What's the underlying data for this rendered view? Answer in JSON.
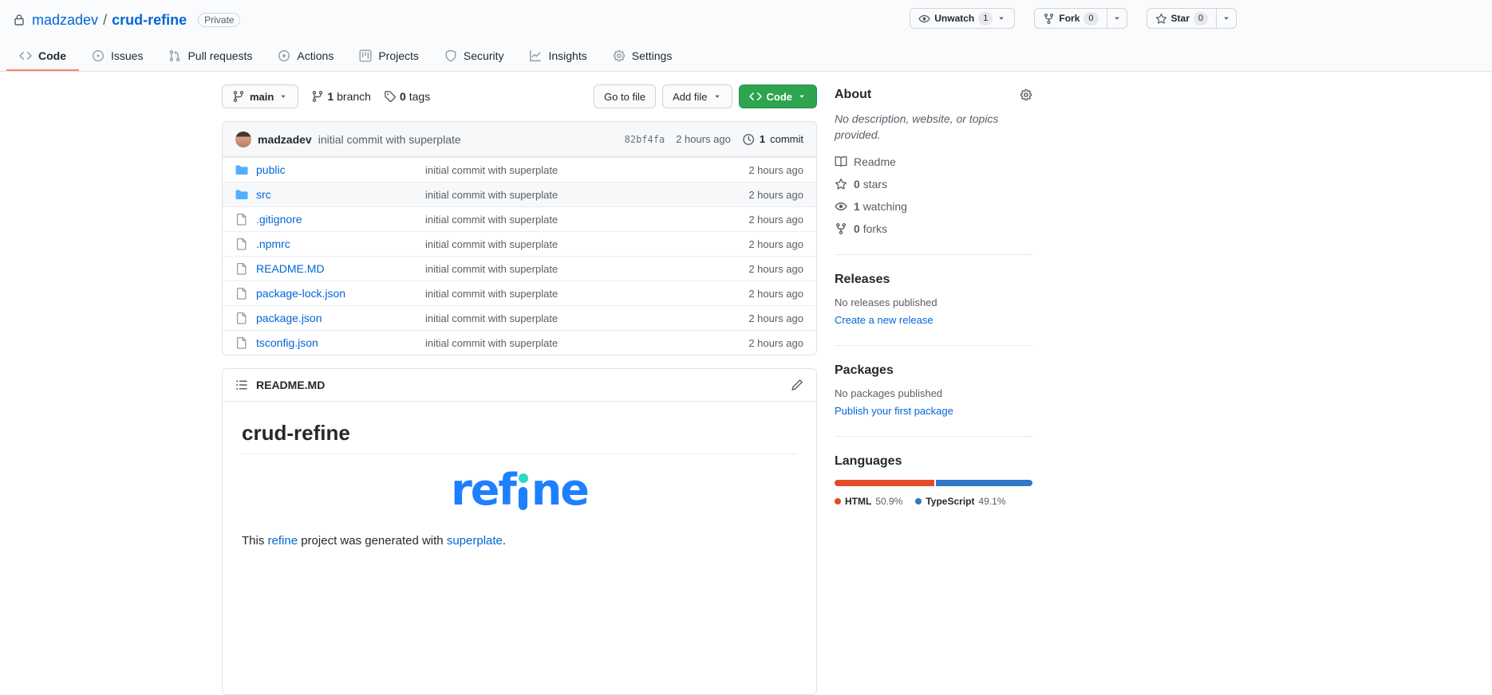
{
  "repo_header": {
    "lock_icon": "lock",
    "owner": "madzadev",
    "separator": "/",
    "repo": "crud-refine",
    "visibility_badge": "Private",
    "unwatch": {
      "icon": "eye",
      "label": "Unwatch",
      "count": "1"
    },
    "fork": {
      "icon": "fork",
      "label": "Fork",
      "count": "0"
    },
    "star": {
      "icon": "star",
      "label": "Star",
      "count": "0"
    }
  },
  "nav": {
    "tabs": [
      {
        "icon": "code",
        "label": "Code",
        "active": true
      },
      {
        "icon": "issue",
        "label": "Issues",
        "active": false
      },
      {
        "icon": "pr",
        "label": "Pull requests",
        "active": false
      },
      {
        "icon": "play",
        "label": "Actions",
        "active": false
      },
      {
        "icon": "project",
        "label": "Projects",
        "active": false
      },
      {
        "icon": "shield",
        "label": "Security",
        "active": false
      },
      {
        "icon": "graph",
        "label": "Insights",
        "active": false
      },
      {
        "icon": "gear",
        "label": "Settings",
        "active": false
      }
    ]
  },
  "toolbar": {
    "branch": {
      "icon": "branch",
      "label": "main"
    },
    "branches": {
      "count": "1",
      "label": "branch"
    },
    "tags": {
      "count": "0",
      "label": "tags"
    },
    "goto_file_label": "Go to file",
    "add_file_label": "Add file",
    "code_label": "Code"
  },
  "commit_bar": {
    "author": "madzadev",
    "message": "initial commit with superplate",
    "sha": "82bf4fa",
    "time": "2 hours ago",
    "count": "1",
    "count_label": "commit"
  },
  "files": [
    {
      "icon": "folder",
      "name": "public",
      "message": "initial commit with superplate",
      "time": "2 hours ago"
    },
    {
      "icon": "folder",
      "name": "src",
      "message": "initial commit with superplate",
      "time": "2 hours ago"
    },
    {
      "icon": "file",
      "name": ".gitignore",
      "message": "initial commit with superplate",
      "time": "2 hours ago"
    },
    {
      "icon": "file",
      "name": ".npmrc",
      "message": "initial commit with superplate",
      "time": "2 hours ago"
    },
    {
      "icon": "file",
      "name": "README.MD",
      "message": "initial commit with superplate",
      "time": "2 hours ago"
    },
    {
      "icon": "file",
      "name": "package-lock.json",
      "message": "initial commit with superplate",
      "time": "2 hours ago"
    },
    {
      "icon": "file",
      "name": "package.json",
      "message": "initial commit with superplate",
      "time": "2 hours ago"
    },
    {
      "icon": "file",
      "name": "tsconfig.json",
      "message": "initial commit with superplate",
      "time": "2 hours ago"
    }
  ],
  "readme": {
    "filename": "README.MD",
    "title": "crud-refine",
    "logo": {
      "word": "refine",
      "part1": "ref",
      "part2": "ne",
      "blue": "#1e7fff",
      "dot_color": "#2cd9c5"
    },
    "paragraph": {
      "t1": "This ",
      "link1": "refine",
      "t2": " project was generated with ",
      "link2": "superplate",
      "t3": "."
    }
  },
  "sidebar": {
    "about": {
      "title": "About",
      "description": "No description, website, or topics provided.",
      "readme_item": {
        "icon": "book",
        "label": "Readme"
      },
      "stars_item": {
        "icon": "star",
        "count": "0",
        "label": "stars"
      },
      "watching_item": {
        "icon": "eye",
        "count": "1",
        "label": "watching"
      },
      "forks_item": {
        "icon": "fork",
        "count": "0",
        "label": "forks"
      }
    },
    "releases": {
      "title": "Releases",
      "empty": "No releases published",
      "link": "Create a new release"
    },
    "packages": {
      "title": "Packages",
      "empty": "No packages published",
      "link": "Publish your first package"
    },
    "languages": {
      "title": "Languages",
      "items": [
        {
          "name": "HTML",
          "percent": "50.9%",
          "color": "#e34c26"
        },
        {
          "name": "TypeScript",
          "percent": "49.1%",
          "color": "#3178c6"
        }
      ]
    }
  },
  "colors": {
    "accent_green": "#2ea44f",
    "tab_underline": "#f9826c",
    "link_blue": "#0366d6",
    "header_bg": "#fafbfc"
  }
}
